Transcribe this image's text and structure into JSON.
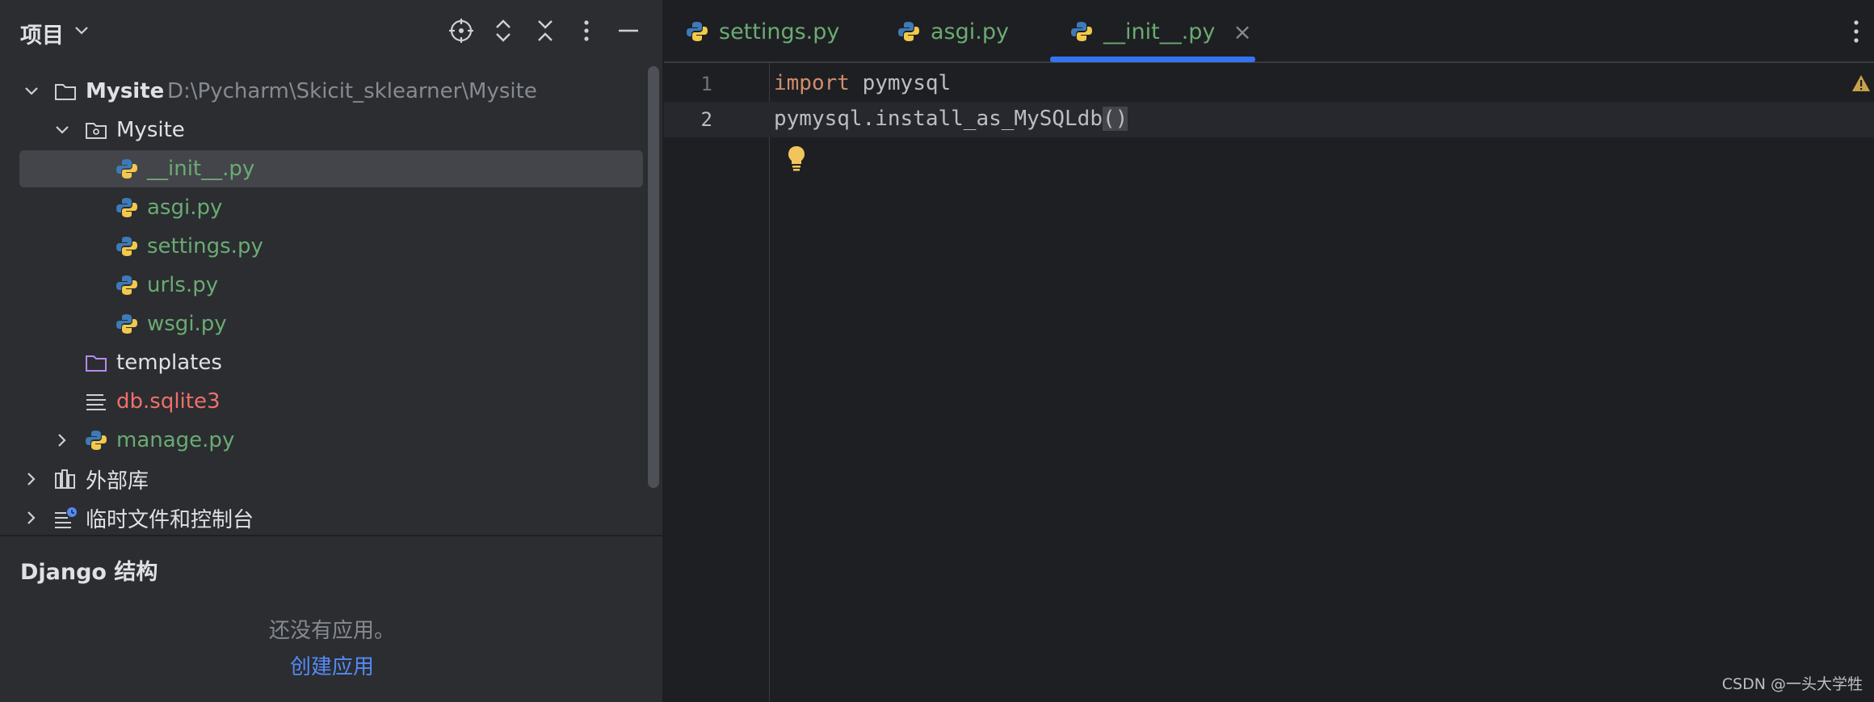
{
  "panel": {
    "title": "项目",
    "tree": [
      {
        "label": "Mysite",
        "path": "D:\\Pycharm\\Skicit_sklearner\\Mysite",
        "icon": "folder-icon"
      },
      {
        "label": "Mysite",
        "icon": "package-folder-icon"
      },
      {
        "label": "__init__.py",
        "icon": "python-file-icon"
      },
      {
        "label": "asgi.py",
        "icon": "python-file-icon"
      },
      {
        "label": "settings.py",
        "icon": "python-file-icon"
      },
      {
        "label": "urls.py",
        "icon": "python-file-icon"
      },
      {
        "label": "wsgi.py",
        "icon": "python-file-icon"
      },
      {
        "label": "templates",
        "icon": "templates-folder-icon"
      },
      {
        "label": "db.sqlite3",
        "icon": "text-file-icon"
      },
      {
        "label": "manage.py",
        "icon": "python-file-icon"
      },
      {
        "label": "外部库",
        "icon": "library-icon"
      },
      {
        "label": "临时文件和控制台",
        "icon": "scratches-icon"
      }
    ]
  },
  "django": {
    "title": "Django 结构",
    "empty_message": "还没有应用。",
    "create_link": "创建应用"
  },
  "tabs": [
    {
      "label": "settings.py"
    },
    {
      "label": "asgi.py"
    },
    {
      "label": "__init__.py",
      "close": "×"
    }
  ],
  "editor": {
    "lines": [
      {
        "number": "1",
        "keyword": "import",
        "rest": " pymysql"
      },
      {
        "number": "2",
        "text": "pymysql.install_as_MySQLdb",
        "parens": "()"
      }
    ],
    "warning_count": "1"
  },
  "watermark": "CSDN @一头大学牲",
  "colors": {
    "accent": "#3574f0",
    "python_file": "#6aab73",
    "error_file": "#f06f6a",
    "keyword": "#cf8e6d",
    "link": "#548af7"
  }
}
